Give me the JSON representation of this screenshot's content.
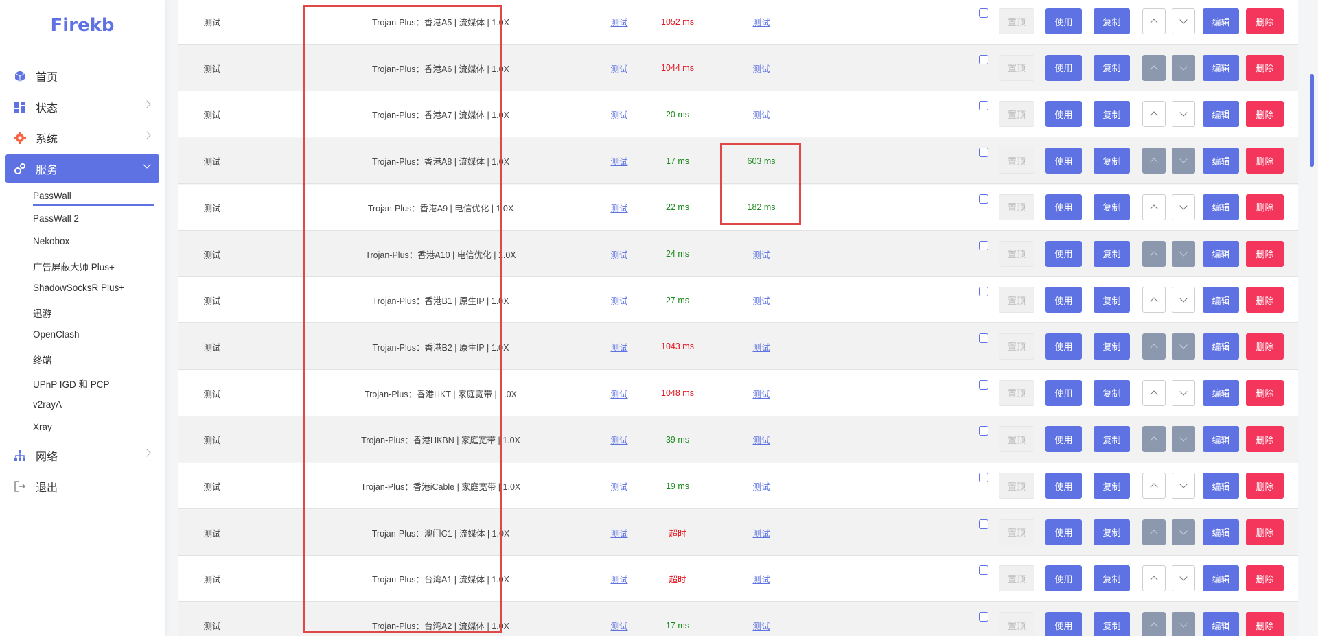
{
  "brand": "Firekb",
  "nav": {
    "home": "首页",
    "status": "状态",
    "system": "系统",
    "services": "服务",
    "network": "网络",
    "logout": "退出",
    "sub": [
      "PassWall",
      "PassWall 2",
      "Nekobox",
      "广告屏蔽大师 Plus+",
      "ShadowSocksR Plus+",
      "迅游",
      "OpenClash",
      "终端",
      "UPnP IGD 和 PCP",
      "v2rayA",
      "Xray"
    ]
  },
  "colors": {
    "accent": "#5e72e4",
    "danger": "#f5365c",
    "ok": "#1a8a1a",
    "bad": "#e8121c",
    "highlight": "#e04848"
  },
  "buttons": {
    "top": "置顶",
    "use": "使用",
    "copy": "复制",
    "edit": "编辑",
    "delete": "删除"
  },
  "rows": [
    {
      "group": "测试",
      "name": "Trojan-Plus：香港A5 | 流媒体 | 1.0X",
      "test1": "测试",
      "ping": "1052 ms",
      "ping_status": "red",
      "test2": "测试",
      "arrows": "light"
    },
    {
      "group": "测试",
      "name": "Trojan-Plus：香港A6 | 流媒体 | 1.0X",
      "test1": "测试",
      "ping": "1044 ms",
      "ping_status": "red",
      "test2": "测试",
      "arrows": "dark"
    },
    {
      "group": "测试",
      "name": "Trojan-Plus：香港A7 | 流媒体 | 1.0X",
      "test1": "测试",
      "ping": "20 ms",
      "ping_status": "green",
      "test2": "测试",
      "arrows": "light"
    },
    {
      "group": "测试",
      "name": "Trojan-Plus：香港A8 | 流媒体 | 1.0X",
      "test1": "测试",
      "ping": "17 ms",
      "ping_status": "green",
      "test2": "603 ms",
      "test2_is_result": true,
      "arrows": "dark"
    },
    {
      "group": "测试",
      "name": "Trojan-Plus：香港A9 | 电信优化 | 1.0X",
      "test1": "测试",
      "ping": "22 ms",
      "ping_status": "green",
      "test2": "182 ms",
      "test2_is_result": true,
      "arrows": "light"
    },
    {
      "group": "测试",
      "name": "Trojan-Plus：香港A10 | 电信优化 | 1.0X",
      "test1": "测试",
      "ping": "24 ms",
      "ping_status": "green",
      "test2": "测试",
      "arrows": "dark"
    },
    {
      "group": "测试",
      "name": "Trojan-Plus：香港B1 | 原生IP | 1.0X",
      "test1": "测试",
      "ping": "27 ms",
      "ping_status": "green",
      "test2": "测试",
      "arrows": "light"
    },
    {
      "group": "测试",
      "name": "Trojan-Plus：香港B2 | 原生IP | 1.0X",
      "test1": "测试",
      "ping": "1043 ms",
      "ping_status": "red",
      "test2": "测试",
      "arrows": "dark"
    },
    {
      "group": "测试",
      "name": "Trojan-Plus：香港HKT | 家庭宽带 | 1.0X",
      "test1": "测试",
      "ping": "1048 ms",
      "ping_status": "red",
      "test2": "测试",
      "arrows": "light"
    },
    {
      "group": "测试",
      "name": "Trojan-Plus：香港HKBN | 家庭宽带 | 1.0X",
      "test1": "测试",
      "ping": "39 ms",
      "ping_status": "green",
      "test2": "测试",
      "arrows": "dark"
    },
    {
      "group": "测试",
      "name": "Trojan-Plus：香港iCable | 家庭宽带 | 1.0X",
      "test1": "测试",
      "ping": "19 ms",
      "ping_status": "green",
      "test2": "测试",
      "arrows": "light"
    },
    {
      "group": "测试",
      "name": "Trojan-Plus：澳门C1 | 流媒体 | 1.0X",
      "test1": "测试",
      "ping": "超时",
      "ping_status": "red",
      "test2": "测试",
      "arrows": "dark"
    },
    {
      "group": "测试",
      "name": "Trojan-Plus：台湾A1 | 流媒体 | 1.0X",
      "test1": "测试",
      "ping": "超时",
      "ping_status": "red",
      "test2": "测试",
      "arrows": "light"
    },
    {
      "group": "测试",
      "name": "Trojan-Plus：台湾A2 | 流媒体 | 1.0X",
      "test1": "测试",
      "ping": "17 ms",
      "ping_status": "green",
      "test2": "测试",
      "arrows": "dark"
    }
  ]
}
